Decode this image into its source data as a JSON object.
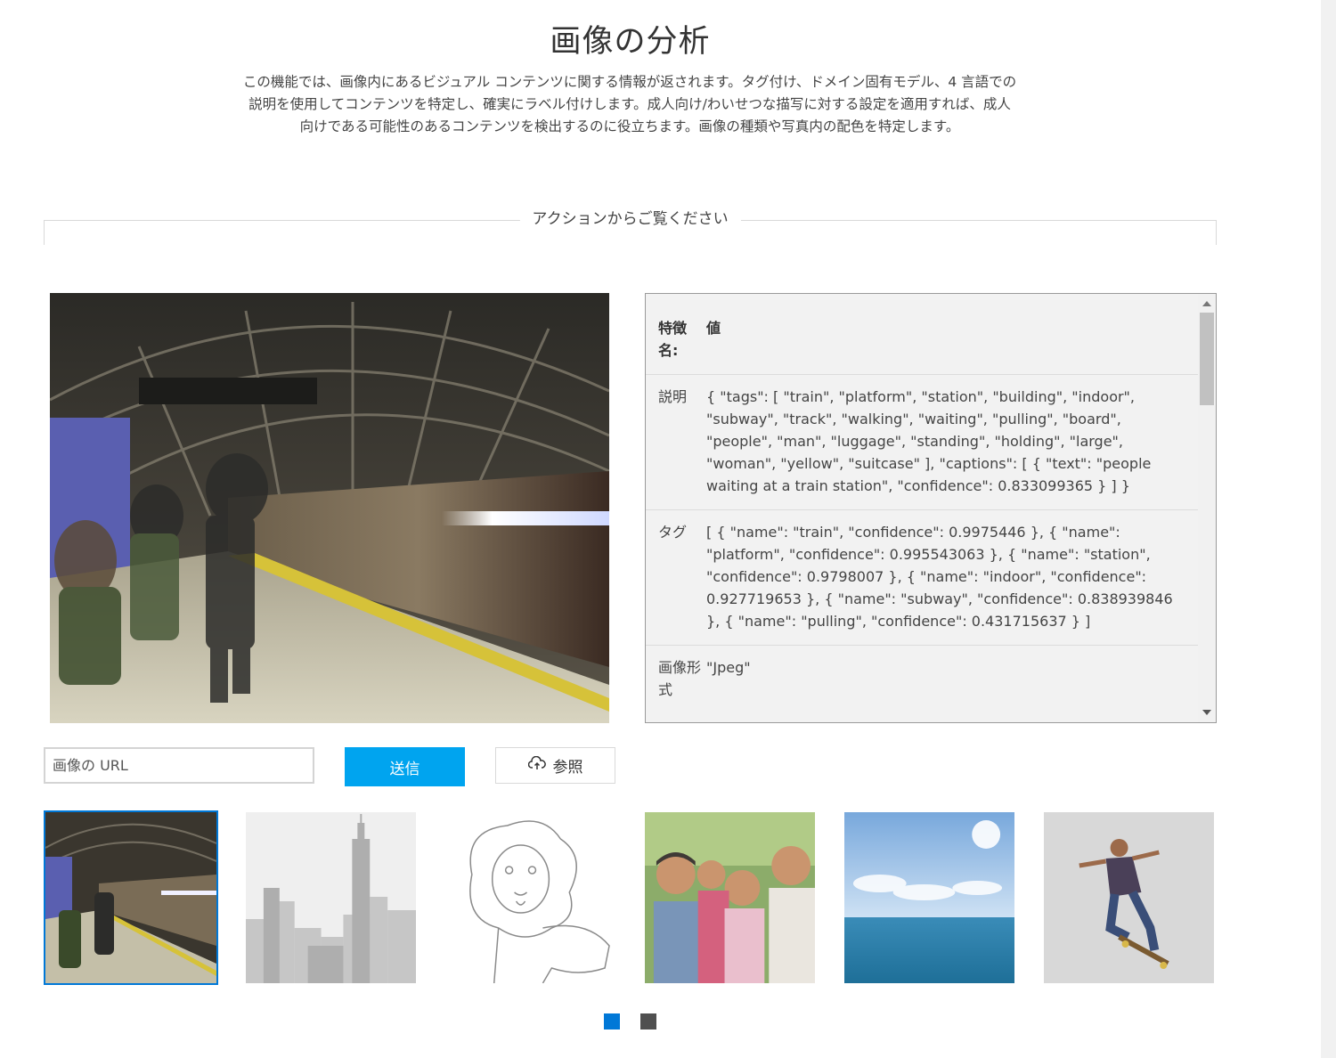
{
  "header": {
    "title": "画像の分析",
    "description": "この機能では、画像内にあるビジュアル コンテンツに関する情報が返されます。タグ付け、ドメイン固有モデル、4 言語での説明を使用してコンテンツを特定し、確実にラベル付けします。成人向け/わいせつな描写に対する設定を適用すれば、成人向けである可能性のあるコンテンツを検出するのに役立ちます。画像の種類や写真内の配色を特定します。"
  },
  "section": {
    "label": "アクションからご覧ください"
  },
  "results": {
    "header_key": "特徴名:",
    "header_value": "値",
    "rows": [
      {
        "key": "説明",
        "value": "{ \"tags\": [ \"train\", \"platform\", \"station\", \"building\", \"indoor\", \"subway\", \"track\", \"walking\", \"waiting\", \"pulling\", \"board\", \"people\", \"man\", \"luggage\", \"standing\", \"holding\", \"large\", \"woman\", \"yellow\", \"suitcase\" ], \"captions\": [ { \"text\": \"people waiting at a train station\", \"confidence\": 0.833099365 } ] }"
      },
      {
        "key": "タグ",
        "value": "[ { \"name\": \"train\", \"confidence\": 0.9975446 }, { \"name\": \"platform\", \"confidence\": 0.995543063 }, { \"name\": \"station\", \"confidence\": 0.9798007 }, { \"name\": \"indoor\", \"confidence\": 0.927719653 }, { \"name\": \"subway\", \"confidence\": 0.838939846 }, { \"name\": \"pulling\", \"confidence\": 0.431715637 } ]"
      },
      {
        "key": "画像形式",
        "value": "\"Jpeg\""
      }
    ]
  },
  "form": {
    "url_placeholder": "画像の URL",
    "submit_label": "送信",
    "browse_label": "参照",
    "browse_icon": "cloud-upload-icon"
  },
  "thumbnails": [
    {
      "name": "subway-platform",
      "selected": true
    },
    {
      "name": "city-skyline",
      "selected": false
    },
    {
      "name": "lion-drawing",
      "selected": false
    },
    {
      "name": "family-photo",
      "selected": false
    },
    {
      "name": "ocean-sky",
      "selected": false
    },
    {
      "name": "skateboarder",
      "selected": false
    }
  ],
  "pagination": {
    "pages": 2,
    "current": 1
  },
  "colors": {
    "accent": "#00a4ef",
    "selected_border": "#0078d7",
    "inactive_dot": "#505050"
  }
}
